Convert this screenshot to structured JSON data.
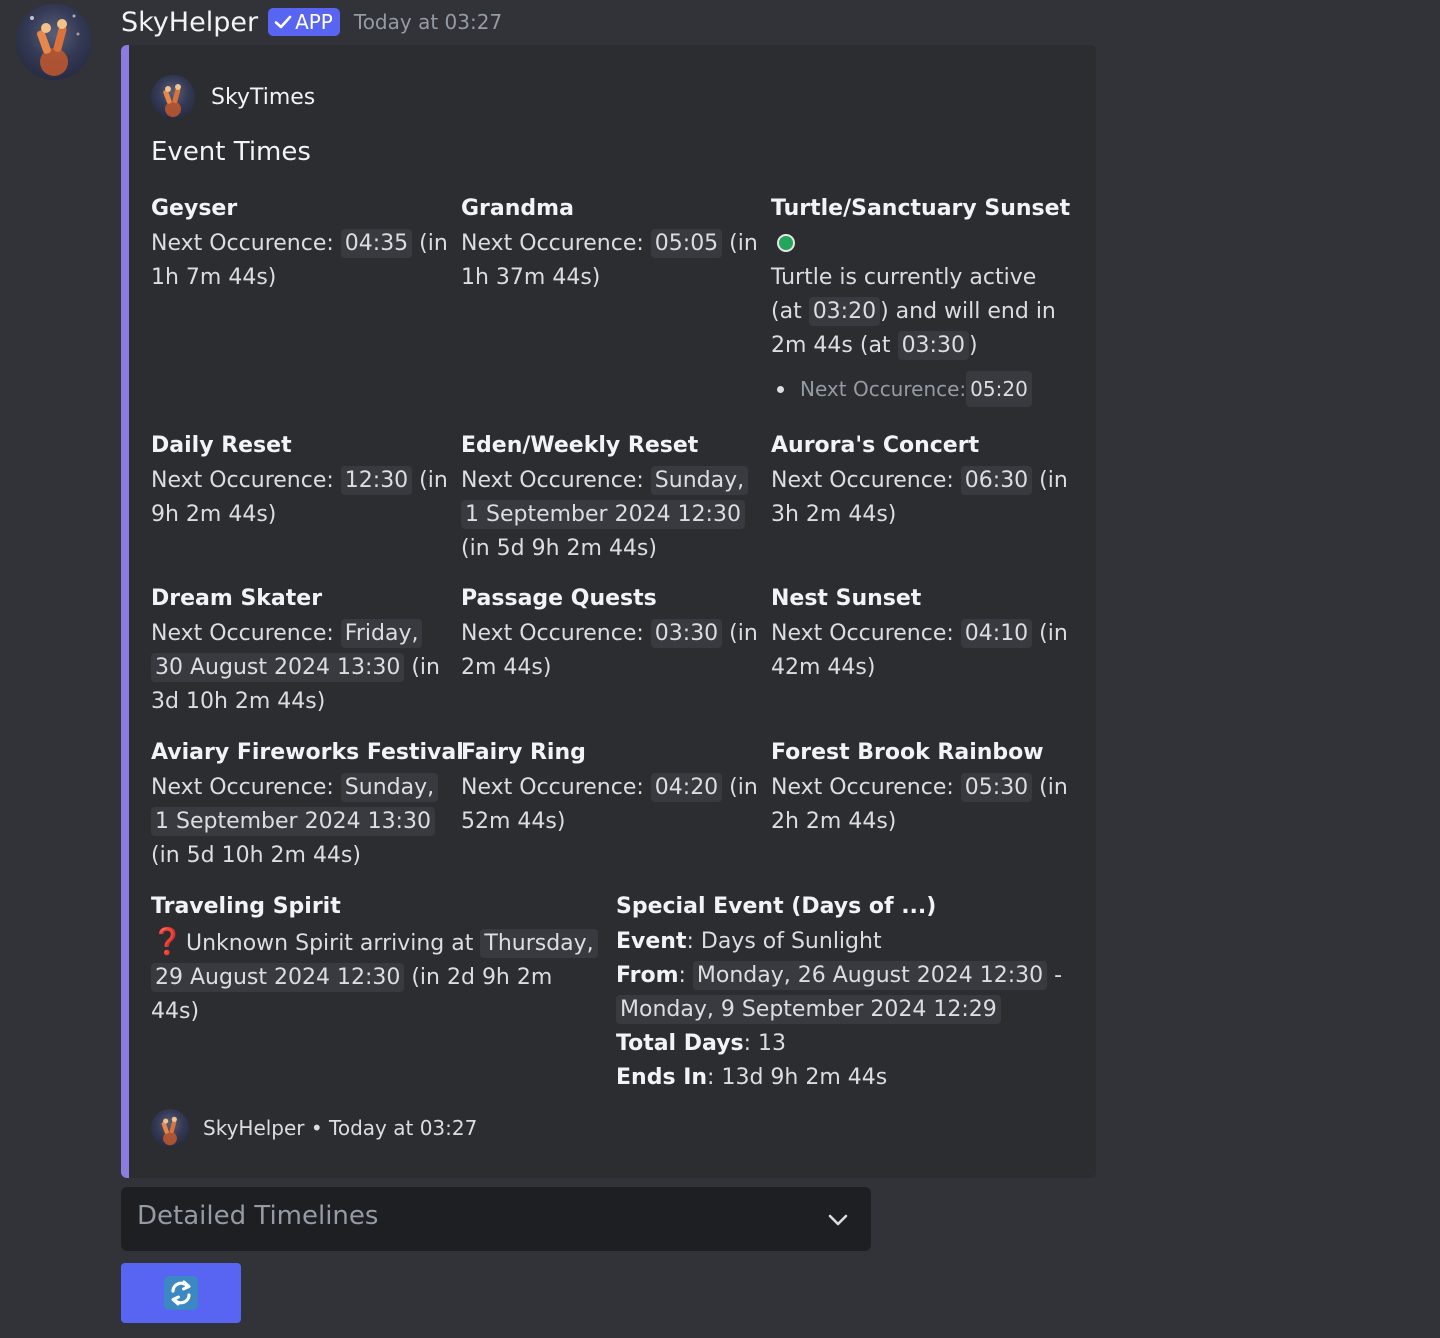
{
  "message": {
    "username": "SkyHelper",
    "badge": "APP",
    "timestamp": "Today at 03:27"
  },
  "embed": {
    "author": "SkyTimes",
    "title": "Event Times",
    "accent_color": "#8c7ce0",
    "footer": "SkyHelper • Today at 03:27",
    "fields": {
      "geyser": {
        "name": "Geyser",
        "prefix": "Next Occurence: ",
        "time": "04:35",
        "suffix": " (in 1h 7m 44s)"
      },
      "grandma": {
        "name": "Grandma",
        "prefix": "Next Occurence: ",
        "time": "05:05",
        "suffix": " (in 1h 37m 44s)"
      },
      "turtle": {
        "name": "Turtle/Sanctuary Sunset",
        "status_icon": "green-circle",
        "text1": "Turtle is currently active (at ",
        "time1": "03:20",
        "text2": ") and will end in 2m 44s (at ",
        "time2": "03:30",
        "text3": ")",
        "next_label": "Next Occurence: ",
        "next_time": "05:20"
      },
      "daily": {
        "name": "Daily Reset",
        "prefix": "Next Occurence: ",
        "time": "12:30",
        "suffix": " (in 9h 2m 44s)"
      },
      "eden": {
        "name": "Eden/Weekly Reset",
        "prefix": "Next Occurence: ",
        "time": "Sunday, 1 September 2024 12:30",
        "suffix": " (in 5d 9h 2m 44s)"
      },
      "aurora": {
        "name": "Aurora's Concert",
        "prefix": "Next Occurence: ",
        "time": "06:30",
        "suffix": " (in 3h 2m 44s)"
      },
      "dream": {
        "name": "Dream Skater",
        "prefix": "Next Occurence: ",
        "time": "Friday, 30 August 2024 13:30",
        "suffix": " (in 3d 10h 2m 44s)"
      },
      "passage": {
        "name": "Passage Quests",
        "prefix": "Next Occurence: ",
        "time": "03:30",
        "suffix": " (in 2m 44s)"
      },
      "nest": {
        "name": "Nest Sunset",
        "prefix": "Next Occurence: ",
        "time": "04:10",
        "suffix": " (in 42m 44s)"
      },
      "aviary": {
        "name": "Aviary Fireworks Festival",
        "prefix": "Next Occurence: ",
        "time": "Sunday, 1 September 2024 13:30",
        "suffix": " (in 5d 10h 2m 44s)"
      },
      "fairy": {
        "name": "Fairy Ring",
        "prefix": "Next Occurence: ",
        "time": "04:20",
        "suffix": " (in 52m 44s)"
      },
      "forest": {
        "name": "Forest Brook Rainbow",
        "prefix": "Next Occurence: ",
        "time": "05:30",
        "suffix": " (in 2h 2m 44s)"
      },
      "spirit": {
        "name": "Traveling Spirit",
        "icon": "❓",
        "prefix": " Unknown Spirit arriving at ",
        "time": "Thursday, 29 August 2024 12:30",
        "suffix": " (in 2d 9h 2m 44s)"
      },
      "special": {
        "name": "Special Event (Days of ...)",
        "event_label": "Event",
        "event_value": ": Days of Sunlight",
        "from_label": "From",
        "from_start": "Monday, 26 August 2024 12:30",
        "from_sep": " - ",
        "from_end": "Monday, 9 September 2024 12:29",
        "days_label": "Total Days",
        "days_value": ": 13",
        "ends_label": "Ends In",
        "ends_value": ": 13d 9h 2m 44s"
      }
    }
  },
  "components": {
    "select_placeholder": "Detailed Timelines",
    "refresh_icon": "refresh-icon",
    "button_color": "#5865f2"
  }
}
